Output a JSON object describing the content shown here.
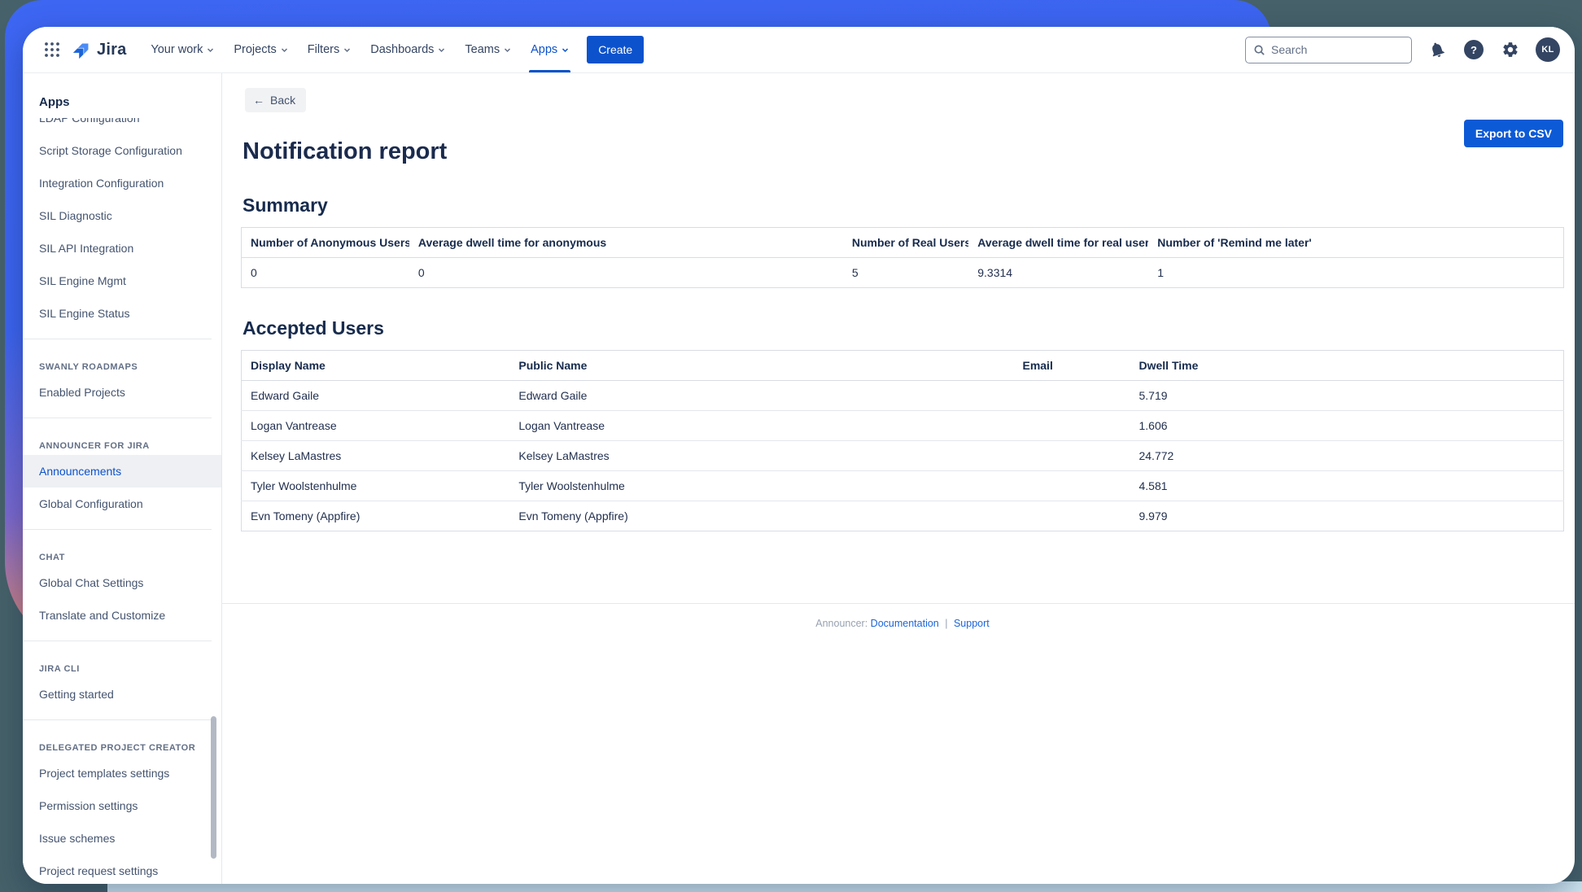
{
  "navbar": {
    "logo_text": "Jira",
    "items": [
      {
        "label": "Your work"
      },
      {
        "label": "Projects"
      },
      {
        "label": "Filters"
      },
      {
        "label": "Dashboards"
      },
      {
        "label": "Teams"
      },
      {
        "label": "Apps"
      }
    ],
    "active_item": "Apps",
    "create_label": "Create",
    "search_placeholder": "Search",
    "avatar_initials": "KL",
    "help_glyph": "?"
  },
  "sidebar": {
    "heading": "Apps",
    "items": [
      {
        "type": "link",
        "label": "LDAP Configuration"
      },
      {
        "type": "link",
        "label": "Script Storage Configuration"
      },
      {
        "type": "link",
        "label": "Integration Configuration"
      },
      {
        "type": "link",
        "label": "SIL Diagnostic"
      },
      {
        "type": "link",
        "label": "SIL API Integration"
      },
      {
        "type": "link",
        "label": "SIL Engine Mgmt"
      },
      {
        "type": "link",
        "label": "SIL Engine Status"
      },
      {
        "type": "section",
        "label": "SWANLY ROADMAPS"
      },
      {
        "type": "link",
        "label": "Enabled Projects"
      },
      {
        "type": "section",
        "label": "ANNOUNCER FOR JIRA"
      },
      {
        "type": "link",
        "label": "Announcements",
        "selected": true
      },
      {
        "type": "link",
        "label": "Global Configuration"
      },
      {
        "type": "section",
        "label": "CHAT"
      },
      {
        "type": "link",
        "label": "Global Chat Settings"
      },
      {
        "type": "link",
        "label": "Translate and Customize"
      },
      {
        "type": "section",
        "label": "JIRA CLI"
      },
      {
        "type": "link",
        "label": "Getting started"
      },
      {
        "type": "section",
        "label": "DELEGATED PROJECT CREATOR"
      },
      {
        "type": "link",
        "label": "Project templates settings"
      },
      {
        "type": "link",
        "label": "Permission settings"
      },
      {
        "type": "link",
        "label": "Issue schemes"
      },
      {
        "type": "link",
        "label": "Project request settings"
      }
    ]
  },
  "main": {
    "back_label": "Back",
    "back_arrow": "←",
    "export_label": "Export to CSV",
    "title": "Notification report",
    "summary": {
      "heading": "Summary",
      "columns": [
        "Number of Anonymous Users",
        "Average dwell time for anonymous",
        "Number of Real Users",
        "Average dwell time for real users",
        "Number of 'Remind me later'"
      ],
      "values": [
        "0",
        "0",
        "5",
        "9.3314",
        "1"
      ]
    },
    "accepted_users": {
      "heading": "Accepted Users",
      "columns": [
        "Display Name",
        "Public Name",
        "Email",
        "Dwell Time"
      ],
      "rows": [
        {
          "display_name": "Edward Gaile",
          "public_name": "Edward Gaile",
          "email": "",
          "dwell_time": "5.719"
        },
        {
          "display_name": "Logan Vantrease",
          "public_name": "Logan Vantrease",
          "email": "",
          "dwell_time": "1.606"
        },
        {
          "display_name": "Kelsey LaMastres",
          "public_name": "Kelsey LaMastres",
          "email": "",
          "dwell_time": "24.772"
        },
        {
          "display_name": "Tyler Woolstenhulme",
          "public_name": "Tyler Woolstenhulme",
          "email": "",
          "dwell_time": "4.581"
        },
        {
          "display_name": "Evn Tomeny (Appfire)",
          "public_name": "Evn Tomeny (Appfire)",
          "email": "",
          "dwell_time": "9.979"
        }
      ]
    },
    "footer": {
      "prefix": "Announcer:",
      "doc_label": "Documentation",
      "separator": "|",
      "support_label": "Support"
    }
  },
  "colors": {
    "accent_blue": "#0C52CC",
    "export_button": "#0D5AD6",
    "title_text": "#172B4D",
    "backdrop_blue": "#3D66F3",
    "backdrop_orange": "#EC8A66",
    "backdrop_teal": "#466169",
    "selected_item_bg": "#EEF0F3"
  }
}
